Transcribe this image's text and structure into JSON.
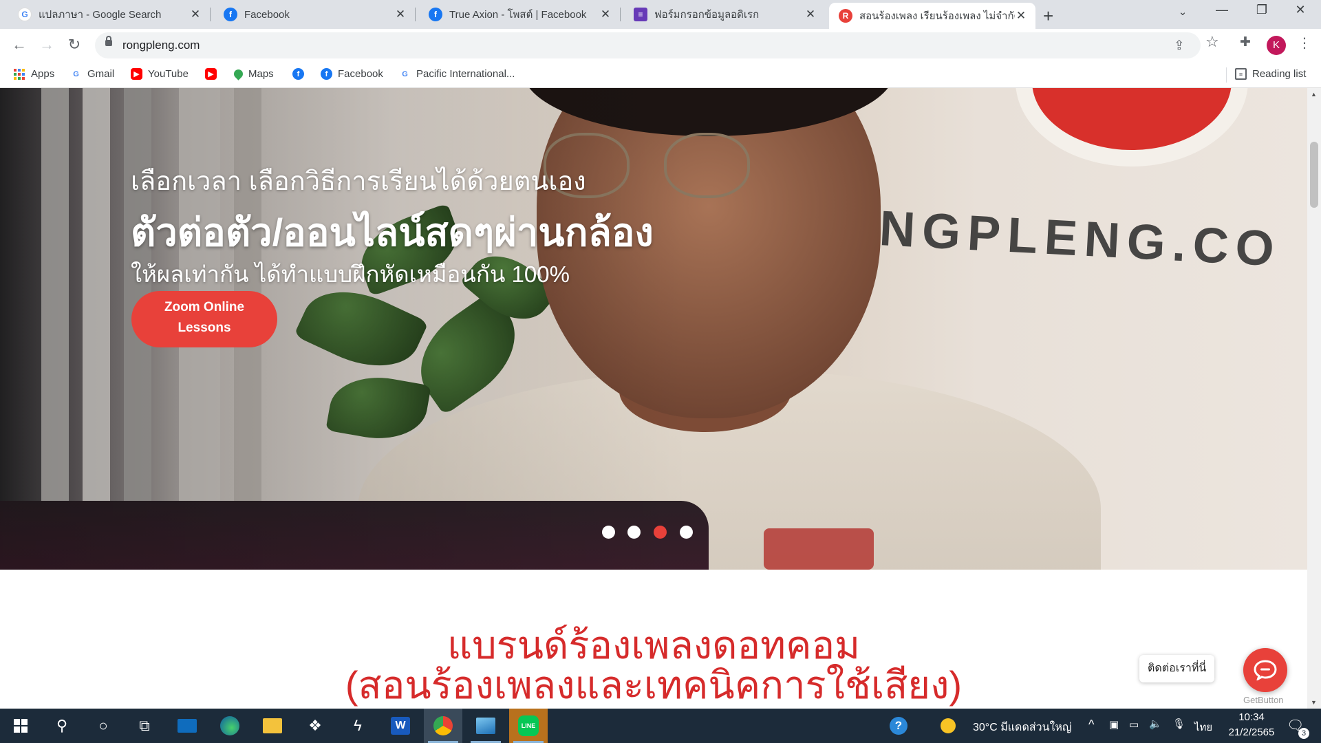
{
  "browser": {
    "tabs": [
      {
        "title": "แปลภาษา - Google Search",
        "icon": "google-icon",
        "active": false
      },
      {
        "title": "Facebook",
        "icon": "facebook-icon",
        "active": false
      },
      {
        "title": "True Axion - โพสต์ | Facebook",
        "icon": "facebook-icon",
        "active": false
      },
      {
        "title": "ฟอร์มกรอกข้อมูลอดิเรก",
        "icon": "forms-icon",
        "active": false
      },
      {
        "title": "สอนร้องเพลง เรียนร้องเพลง ไม่จำกัดป",
        "icon": "rongpleng-icon",
        "active": true
      }
    ],
    "url": "rongpleng.com",
    "profile_initial": "K",
    "bookmarks": [
      {
        "label": "Apps",
        "icon": "apps-grid-icon"
      },
      {
        "label": "Gmail",
        "icon": "google-icon"
      },
      {
        "label": "YouTube",
        "icon": "youtube-icon"
      },
      {
        "label": "",
        "icon": "youtube-icon"
      },
      {
        "label": "Maps",
        "icon": "maps-icon"
      },
      {
        "label": "",
        "icon": "facebook-icon"
      },
      {
        "label": "Facebook",
        "icon": "facebook-icon"
      },
      {
        "label": "Pacific International...",
        "icon": "google-icon"
      }
    ],
    "reading_list": "Reading list"
  },
  "hero": {
    "line1": "เลือกเวลา เลือกวิธีการเรียนได้ด้วยตนเอง",
    "line2": "ตัวต่อตัว/ออนไลน์สดๆผ่านกล้อง",
    "line3": "ให้ผลเท่ากัน ได้ทำแบบฝึกหัดเหมือนกัน 100%",
    "button_label_1": "Zoom Online",
    "button_label_2": "Lessons",
    "wall_text": "RONGPLENG.CO",
    "slider_total": 4,
    "slider_active": 3
  },
  "section": {
    "title_line1": "แบรนด์ร้องเพลงดอทคอม",
    "title_line2": "(สอนร้องเพลงและเทคนิคการใช้เสียง)"
  },
  "contact": {
    "label": "ติดต่อเราที่นี่",
    "powered_by": "GetButton"
  },
  "taskbar": {
    "weather": "30°C มีแดดส่วนใหญ่",
    "language": "ไทย",
    "time": "10:34",
    "date": "21/2/2565",
    "notifications": "3"
  },
  "colors": {
    "accent_red": "#e8413a",
    "title_red": "#d62b2b",
    "facebook_blue": "#1877f2"
  }
}
